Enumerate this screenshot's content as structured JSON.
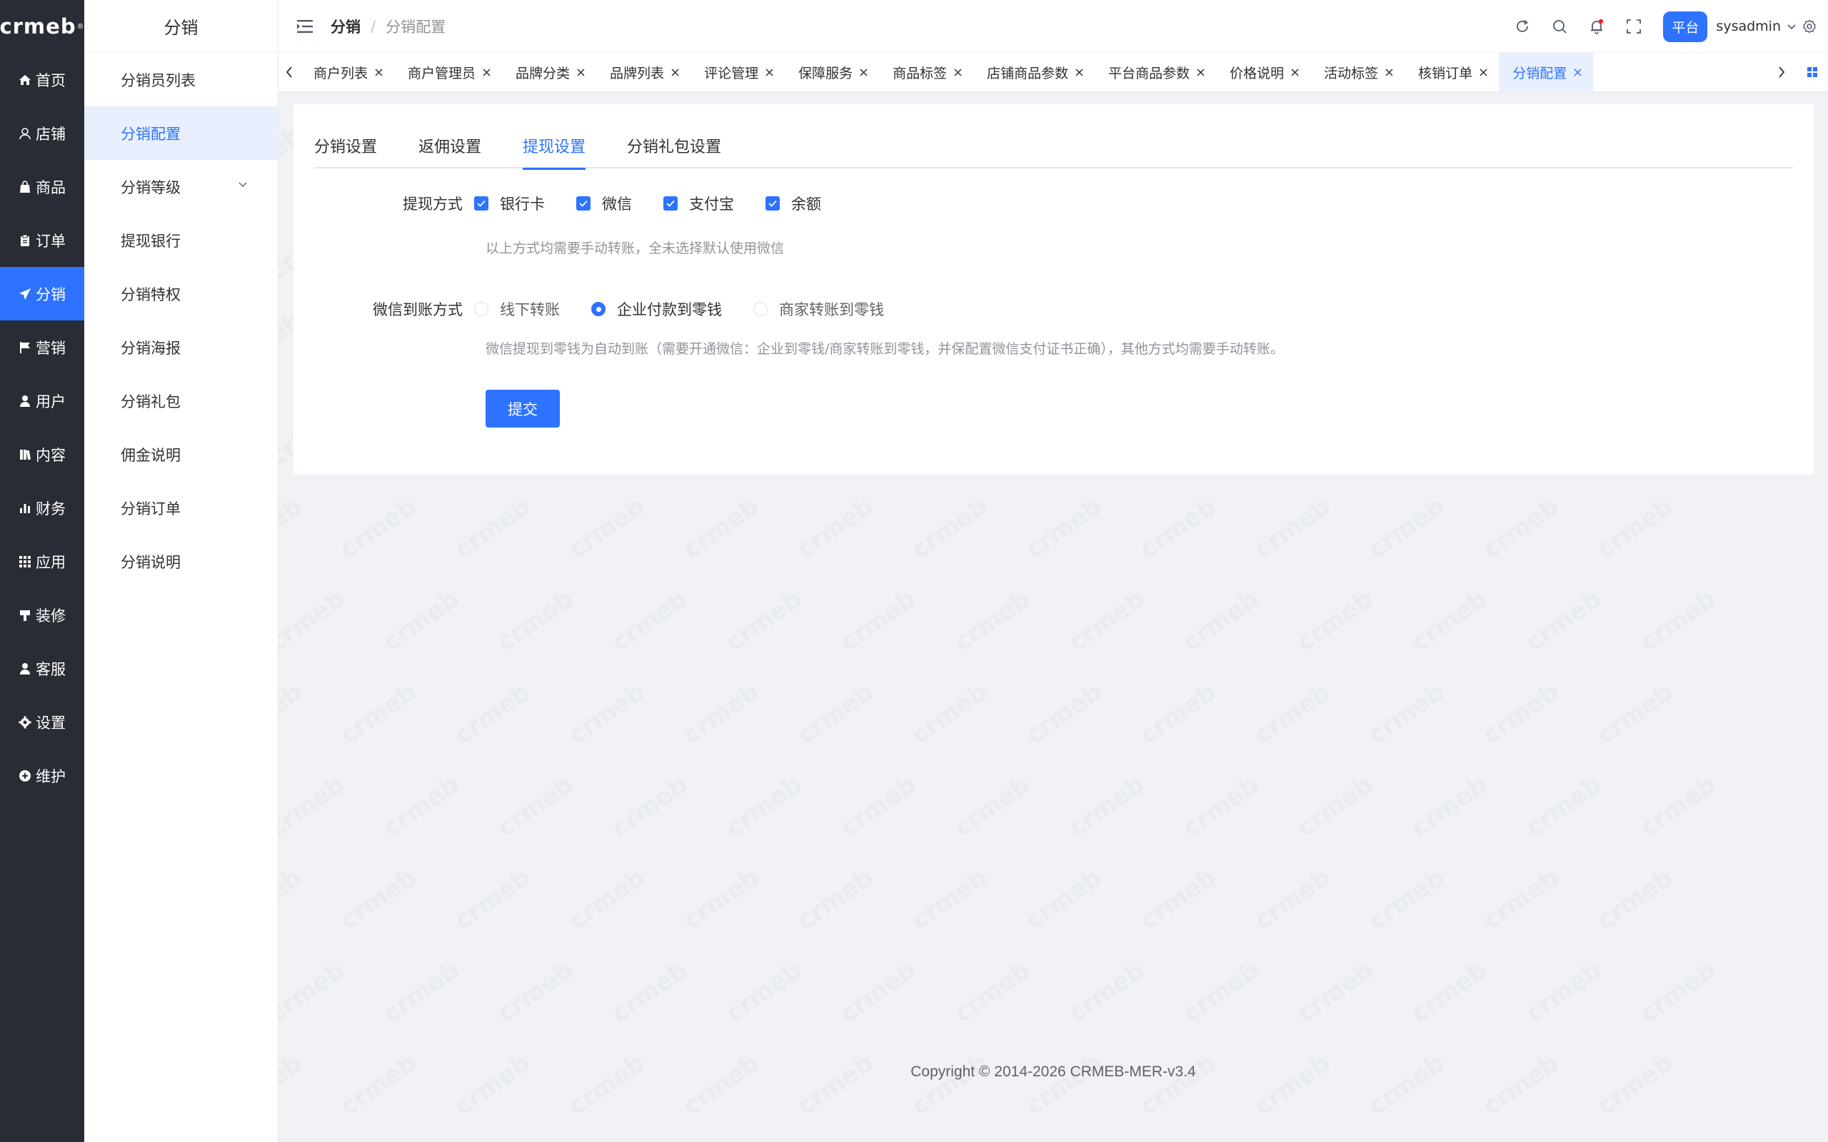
{
  "brand": {
    "logo_text": "crmeb",
    "logo_mark": "®"
  },
  "rail": {
    "items": [
      {
        "label": "首页",
        "icon": "home-icon"
      },
      {
        "label": "店铺",
        "icon": "store-icon"
      },
      {
        "label": "商品",
        "icon": "bag-icon"
      },
      {
        "label": "订单",
        "icon": "clipboard-icon"
      },
      {
        "label": "分销",
        "icon": "send-icon",
        "active": true
      },
      {
        "label": "营销",
        "icon": "flag-icon"
      },
      {
        "label": "用户",
        "icon": "user-icon"
      },
      {
        "label": "内容",
        "icon": "book-icon"
      },
      {
        "label": "财务",
        "icon": "bar-chart-icon"
      },
      {
        "label": "应用",
        "icon": "grid-icon"
      },
      {
        "label": "装修",
        "icon": "brush-icon"
      },
      {
        "label": "客服",
        "icon": "headset-icon"
      },
      {
        "label": "设置",
        "icon": "gear-icon"
      },
      {
        "label": "维护",
        "icon": "plus-circle-icon"
      }
    ]
  },
  "subnav": {
    "title": "分销",
    "items": [
      {
        "label": "分销员列表"
      },
      {
        "label": "分销配置",
        "active": true
      },
      {
        "label": "分销等级",
        "has_children": true
      },
      {
        "label": "提现银行"
      },
      {
        "label": "分销特权"
      },
      {
        "label": "分销海报"
      },
      {
        "label": "分销礼包"
      },
      {
        "label": "佣金说明"
      },
      {
        "label": "分销订单"
      },
      {
        "label": "分销说明"
      }
    ]
  },
  "header": {
    "breadcrumb": [
      "分销",
      "分销配置"
    ],
    "separator": "/",
    "role_badge": "平台",
    "username": "sysadmin"
  },
  "tags": [
    {
      "label": "商户列表"
    },
    {
      "label": "商户管理员"
    },
    {
      "label": "品牌分类"
    },
    {
      "label": "品牌列表"
    },
    {
      "label": "评论管理"
    },
    {
      "label": "保障服务"
    },
    {
      "label": "商品标签"
    },
    {
      "label": "店铺商品参数"
    },
    {
      "label": "平台商品参数"
    },
    {
      "label": "价格说明"
    },
    {
      "label": "活动标签"
    },
    {
      "label": "核销订单"
    },
    {
      "label": "分销配置",
      "active": true
    }
  ],
  "settings": {
    "tabs": [
      {
        "label": "分销设置"
      },
      {
        "label": "返佣设置"
      },
      {
        "label": "提现设置",
        "active": true
      },
      {
        "label": "分销礼包设置"
      }
    ],
    "withdraw_method": {
      "label": "提现方式",
      "options": [
        {
          "label": "银行卡",
          "checked": true
        },
        {
          "label": "微信",
          "checked": true
        },
        {
          "label": "支付宝",
          "checked": true
        },
        {
          "label": "余额",
          "checked": true
        }
      ],
      "hint": "以上方式均需要手动转账，全未选择默认使用微信"
    },
    "wechat_method": {
      "label": "微信到账方式",
      "options": [
        {
          "label": "线下转账",
          "checked": false
        },
        {
          "label": "企业付款到零钱",
          "checked": true
        },
        {
          "label": "商家转账到零钱",
          "checked": false
        }
      ],
      "hint": "微信提现到零钱为自动到账（需要开通微信：企业到零钱/商家转账到零钱，并保配置微信支付证书正确），其他方式均需要手动转账。"
    },
    "submit_label": "提交"
  },
  "footer": {
    "copyright": "Copyright © 2014-2026 CRMEB-MER-v3.4"
  },
  "colors": {
    "primary": "#2d73ff",
    "rail_bg": "#282c34",
    "page_bg": "#f0f2f5"
  }
}
